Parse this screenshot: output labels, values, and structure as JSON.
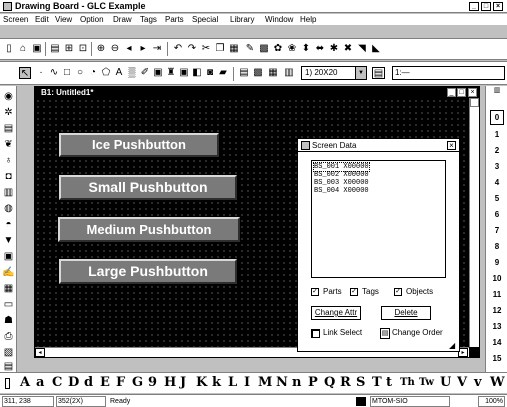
{
  "window": {
    "title": "Drawing Board - GLC Example",
    "minimize": "_",
    "maximize": "□",
    "close": "×"
  },
  "menu": [
    "Screen",
    "Edit",
    "View",
    "Option",
    "Draw",
    "Tags",
    "Parts",
    "Special",
    "Library",
    "Window",
    "Help"
  ],
  "toolbar2": {
    "zoom_select": "1) 20X20",
    "zoom_arrow": "▼",
    "right_field": "1:—"
  },
  "document": {
    "title": "B1: Untitled1*",
    "minimize": "_",
    "maximize": "□",
    "close": "×"
  },
  "pushbuttons": [
    "Ice Pushbutton",
    "Small Pushbutton",
    "Medium Pushbutton",
    "Large Pushbutton"
  ],
  "screen_data": {
    "title": "Screen Data",
    "close": "×",
    "items": [
      "BS_001 X00000",
      "BS_002 X00000",
      "BS_003 X00000",
      "BS_004 X00000"
    ],
    "checkboxes": [
      {
        "label": "Parts",
        "checked": true
      },
      {
        "label": "Tags",
        "checked": true
      },
      {
        "label": "Objects",
        "checked": true
      }
    ],
    "change_attr": "Change Attr",
    "delete": "Delete",
    "link_select": "Link Select",
    "change_order": "Change Order"
  },
  "right_numbers": [
    "0",
    "1",
    "2",
    "3",
    "4",
    "5",
    "6",
    "7",
    "8",
    "9",
    "10",
    "11",
    "12",
    "13",
    "14",
    "15"
  ],
  "font_chars": [
    "A",
    "a",
    "C",
    "D",
    "d",
    "E",
    "F",
    "G",
    "9",
    "H",
    "J",
    "K",
    "k",
    "L",
    "I",
    "M",
    "N",
    "n",
    "P",
    "Q",
    "R",
    "S",
    "T",
    "t",
    "Th",
    "Tw",
    "U",
    "V",
    "v",
    "W"
  ],
  "status": {
    "coords": "311, 238",
    "size": "352(2X)",
    "ready": "Ready",
    "port": "MTOM-SIO",
    "zoom": "100%"
  }
}
